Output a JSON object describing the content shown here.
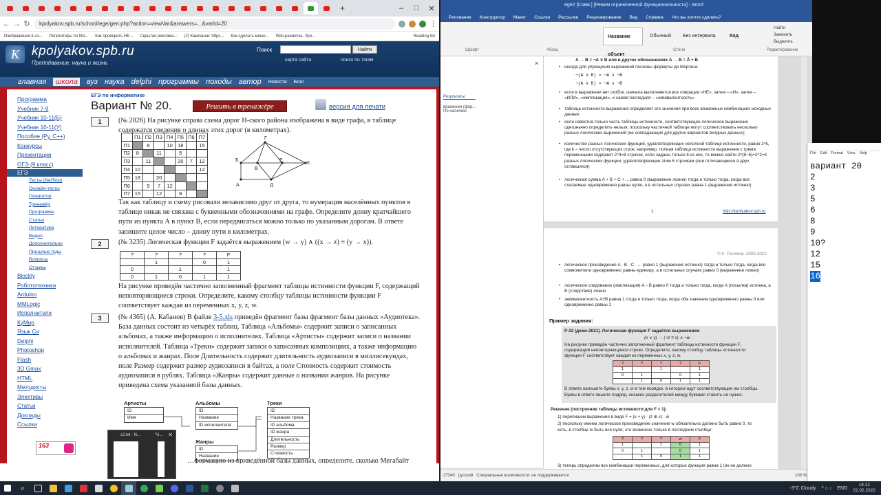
{
  "browser": {
    "url": "kpolyakov.spb.ru/school/ege/gen.php?action=viewVar&answers=...&varId=20",
    "bookmarks": [
      "Изображения в со...",
      "Репетиторы по Ма...",
      "Как проверить НЕ...",
      "Скрытая реклама...",
      "(2) Кампании: https...",
      "Как сделать меню...",
      "Wiki-разметка. Уро...",
      "Reading list"
    ],
    "site": {
      "title": "kpolyakov.spb.ru",
      "slogan": "Преподавание, наука и жизнь",
      "search_label": "Поиск",
      "search_button": "Найти",
      "sitemap_link": "карта сайта",
      "tags_link": "поиск по тэгам",
      "nav": [
        "главная",
        "школа",
        "вуз",
        "наука",
        "delphi",
        "программы",
        "походы",
        "автор"
      ],
      "nav_small": [
        "Новости",
        "Блог"
      ]
    },
    "sidebar": {
      "items_top": [
        "Программа",
        "Учебник 7-9",
        "Учебник 10-11(Б)",
        "Учебник 10-11(У)",
        "Пособие (Ру, С++)",
        "Конкурсы",
        "Презентации",
        "ОГЭ (9 класс)"
      ],
      "active": "ЕГЭ",
      "sub": [
        "Тесты (NetTest)",
        "Онлайн-тесты",
        "Генератор",
        "Тренажёр",
        "Программы",
        "Статьи",
        "Литература",
        "Видео",
        "Дополнительно",
        "Прошлые годы",
        "Вопросы",
        "Отзывы"
      ],
      "items_bottom": [
        "Blockly",
        "Робототехника",
        "Arduino",
        "MMLogic",
        "Исполнители",
        "КуМир",
        "Язык Си",
        "Delphi",
        "Photoshop",
        "Flash",
        "3D Gmax",
        "HTML",
        "Методисты",
        "Элективы",
        "Статьи",
        "Доклады",
        "Ссылки"
      ],
      "rating_badge": "163"
    },
    "main": {
      "crumb": "ЕГЭ по информатике",
      "title": "Вариант № 20.",
      "trainer_button": "Решить в тренажёре",
      "print_link": "версия для печати",
      "q1_num": "1",
      "q1_text": "(№ 2826) На рисунке справа схема дорог Н-ского района изображена в виде графа, в таблице содержатся сведения о длинах этих дорог (в километрах).",
      "q1_text2": "Так как таблицу и схему рисовали независимо друг от друга, то нумерация населённых пунктов в таблице никак не связана с буквенными обозначениями на графе. Определите длину кратчайшего пути из пункта А в пункт В, если передвигаться можно только по указанным дорогам. В ответе запишите целое число – длину пути в километрах.",
      "dist_table": {
        "header": [
          "",
          "П1",
          "П2",
          "П3",
          "П4",
          "П5",
          "П6",
          "П7"
        ],
        "rows": [
          [
            "П1",
            "",
            "8",
            "",
            "10",
            "18",
            "",
            "15"
          ],
          [
            "П2",
            "8",
            "",
            "11",
            "",
            "5",
            "",
            ""
          ],
          [
            "П3",
            "",
            "11",
            "",
            "",
            "20",
            "7",
            "12"
          ],
          [
            "П4",
            "10",
            "",
            "",
            "",
            "",
            "",
            "12"
          ],
          [
            "П5",
            "18",
            "",
            "20",
            "",
            "",
            "",
            ""
          ],
          [
            "П6",
            "",
            "5",
            "7",
            "12",
            "",
            "",
            ""
          ],
          [
            "П7",
            "15",
            "",
            "12",
            "",
            "9",
            "",
            ""
          ]
        ]
      },
      "graph_labels": [
        "Г",
        "Б",
        "В",
        "Е",
        "К",
        "А",
        "Д"
      ],
      "q2_num": "2",
      "q2_text": "(№ 3235) Логическая функция F задаётся выражением (w → y) ∧ ((x → z) ≡ (y → x)).",
      "truth_table": {
        "header": [
          "?",
          "?",
          "?",
          "?",
          "F"
        ],
        "rows": [
          [
            "",
            "1",
            "",
            "0",
            "1"
          ],
          [
            "0",
            "",
            "1",
            "",
            "1"
          ],
          [
            "0",
            "1",
            "0",
            "1",
            "1"
          ]
        ]
      },
      "q2_text2": "На рисунке приведён частично заполненный фрагмент таблицы истинности функции F, содержащий неповторяющиеся строки. Определите, какому столбцу таблицы истинности функции F соответствует каждая из переменных x, y, z, w.",
      "q3_num": "3",
      "q3_text_prefix": "(№ 4365) (А. Кабанов) В файле ",
      "q3_file": "3-5.xls",
      "q3_text_rest": " приведён фрагмент базы фрагмент базы данных «Аудиотека». База данных состоит из четырёх таблиц. Таблица «Альбомы» содержит записи о записанных альбомах, а также информацию о исполнителях. Таблица «Артисты» содержит записи о названии исполнителей. Таблица «Треки» содержит записи о записанных композициях, а также информацию о альбомах и жанрах. Поле Длительность содержит длительность аудиозаписи в миллисекундах, поле Размер содержит размер аудиозаписи в байтах, а поле Стоимость содержит стоимость аудиозаписи в рублях. Таблица «Жанры» содержит данные о названии жанров. На рисунке приведена схема указанной базы данных.",
      "q3_tail": "…формацию из приведённой базы данных, определите, сколько Мегабайт",
      "db": {
        "artists": {
          "title": "Артисты",
          "fields": [
            "ID",
            "Имя"
          ]
        },
        "albums": {
          "title": "Альбомы",
          "fields": [
            "ID",
            "Название",
            "ID исполнителя"
          ]
        },
        "tracks": {
          "title": "Треки",
          "fields": [
            "ID",
            "Название трека",
            "ID альбома",
            "ID жанра",
            "Длительность",
            "Размер",
            "Стоимость"
          ]
        },
        "genres": {
          "title": "Жанры",
          "fields": [
            "ID",
            "Название"
          ]
        }
      }
    },
    "thumb_titles": [
      "c2.txt - N...",
      "\"U..."
    ]
  },
  "word": {
    "title": "ege2 [Совм.] [Режим ограниченной функциональности] - Word",
    "tabs": [
      "Рисование",
      "Конструктор",
      "Макет",
      "Ссылки",
      "Рассылки",
      "Рецензирование",
      "Вид",
      "Справка",
      "Что вы хотите сделать?"
    ],
    "styles": [
      "Название объект",
      "Обычный",
      "Без интервала",
      "Код"
    ],
    "ribbon_groups": [
      "Шрифт",
      "Абзац",
      "Стили",
      "Редактирование"
    ],
    "edit_buttons": [
      "Найти",
      "Заменить",
      "Выделить"
    ],
    "nav_pane": [
      "Результаты",
      "вражения (фор...",
      "По наличию"
    ],
    "page1": {
      "formula_line": "A → B = ¬A ∨ B или в других обозначениях A → B = Ā + B",
      "bullets": [
        "иногда для упрощения выражений полезны формулы де Моргана:",
        "¬(A ∧ B) = ¬A ∨ ¬B",
        "¬(A ∨ B) = ¬A ∧ ¬B",
        "если в выражении нет скобок, сначала выполняются все операции «НЕ», затем – «И», затем – «ИЛИ», «импликация», и самая последняя – «эквивалентность»",
        "таблица истинности выражения определяет его значения при всех возможных комбинациях исходных данных",
        "если известна только часть таблицы истинности, соответствующее логическое выражение однозначно определить нельзя, поскольку частичной таблице могут соответствовать несколько разных логических выражений (не совпадающих для других вариантов входных данных);",
        "количество разных логических функций, удовлетворяющих неполной таблице истинности, равно 2^k, где k – число отсутствующих строк; например, полная таблица истинности выражения с тремя переменными содержит 2^3=8 строчек, если заданы только 6 из них, то можно найти 2^(8−6)=2^2=4 разных логических функции, удовлетворяющие этим 6 строчкам (они отличающиеся в двух оставшихся)",
        "логическая сумма A + B + C + ... равна 0 (выражение ложно) тогда и только тогда, когда все слагаемые одновременно равны нулю, а в остальных случаях равна 1 (выражение истинно)"
      ],
      "page_num": "1",
      "footer_link": "http://kpolyakov.spb.ru"
    },
    "page2": {
      "copyright": "© К. Поляков, 2009-2022",
      "bullets": [
        "логическое произведение A · B · C · ... равно 1 (выражение истинно) тогда и только тогда, когда все сомножители одновременно равны единице, а в остальных случаях равно 0 (выражение ложно)",
        "логическое следование (импликация) A→B равно 0 тогда и только тогда, когда A (посылка) истинна, а B (следствие) ложно",
        "эквивалентность A≡B равна 1 тогда и только тогда, когда оба значения одновременно равны 0 или одновременно равны 1"
      ],
      "example_heading": "Пример задания:",
      "example_lines": [
        "Р-22 (демо-2021). Логическая функция F задаётся выражением",
        "(x ∨ y) → (¬z ≡ x) ∧ ¬w.",
        "На рисунке приведён частично заполненный фрагмент таблицы истинности функции F,",
        "содержащий неповторяющиеся строки. Определите, какому столбцу таблицы истинности",
        "функции F соответствует каждая из переменных x, y, z, w."
      ],
      "example_table": {
        "header": [
          "?",
          "?",
          "?",
          "?",
          "F"
        ],
        "rows": [
          [
            "1",
            "",
            "1",
            "",
            "1"
          ],
          [
            "0",
            "1",
            "",
            "0",
            "1"
          ],
          [
            "",
            "1",
            "0",
            "1",
            "1"
          ]
        ]
      },
      "answer_lines": [
        "В ответе напишите буквы x, y, z, w в том порядке, в котором идут соответствующие им столбцы.",
        "Буквы в ответе пишите подряд, никаких разделителей между буквами ставить не нужно."
      ],
      "solution_heading": "Решение (построение таблицы истинности для F = 1):",
      "solution_lines": [
        "1)   перепишем выражения в виде  F = (x + y) · (z ⊕ x) · w̄",
        "2)   поскольку имеем логическое произведение значение w обязательно должно быть равно 0, то",
        "      есть, в столбце w быть все нули; это возможно только в последнем столбце:"
      ],
      "solution_table": {
        "header": [
          "?",
          "?",
          "?",
          "w",
          "F"
        ],
        "rows": [
          [
            "1",
            "",
            "1",
            "0",
            "1"
          ],
          [
            "0",
            "1",
            "",
            "0",
            "1"
          ],
          [
            "",
            "1",
            "0",
            "1",
            "1"
          ]
        ]
      },
      "step3": "3)   теперь определим все комбинации переменных, для которых функция равна 1 (их не должно"
    },
    "status": {
      "left": "27340",
      "lang": "русский",
      "accessibility": "Специальные возможности: не поддерживается",
      "zoom": "100 %"
    }
  },
  "notepad": {
    "title": "",
    "menu": [
      "File",
      "Edit",
      "Format",
      "View",
      "Help"
    ],
    "lines": [
      "вариант 20",
      "2",
      "3",
      "5",
      "6",
      "8",
      "9",
      "10?",
      "12",
      "15",
      "16"
    ],
    "selected_line": "16"
  },
  "taskbar": {
    "temperature": "-3°C  Cloudy",
    "lang": "ENG",
    "time": "18:12",
    "date": "02.02.2022"
  }
}
